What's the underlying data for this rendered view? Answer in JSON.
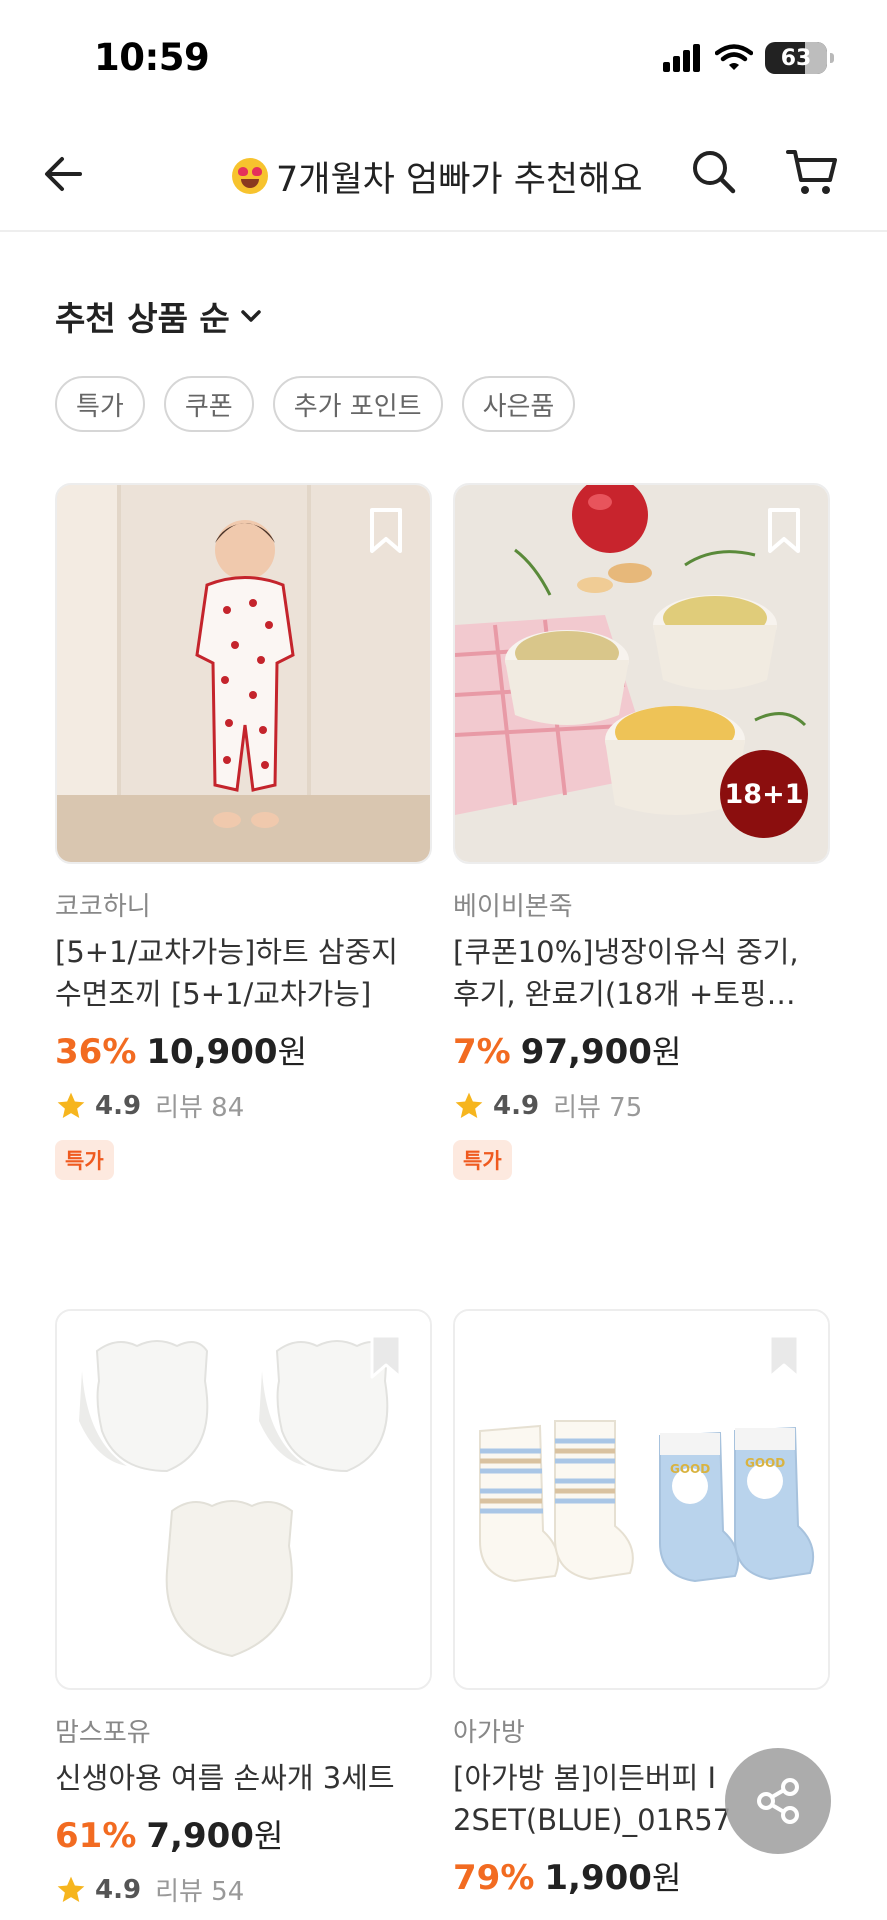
{
  "status_bar": {
    "time": "10:59",
    "battery": "63"
  },
  "nav": {
    "title": "7개월차 엄빠가 추천해요",
    "title_emoji": "smiling-face-with-heart-eyes-icon"
  },
  "sort": {
    "label": "추천 상품 순"
  },
  "filters": [
    "특가",
    "쿠폰",
    "추가 포인트",
    "사은품"
  ],
  "colors": {
    "discount": "#f26b21",
    "badge_bg": "#fde9df",
    "badge_text": "#ef5a1f",
    "star": "#f6b51e"
  },
  "products": [
    {
      "image": "baby-heart-sleepsuit-photo",
      "brand": "코코하니",
      "name": "[5+1/교차가능]하트 삼중지 수면조끼 [5+1/교차가능]",
      "discount": "36%",
      "price": "10,900",
      "currency": "원",
      "rating": "4.9",
      "review": "리뷰 84",
      "badge": "특가"
    },
    {
      "image": "baby-food-cups-photo",
      "image_badge": "18+1",
      "brand": "베이비본죽",
      "name": "[쿠폰10%]냉장이유식 중기, 후기, 완료기(18개 +토핑…",
      "discount": "7%",
      "price": "97,900",
      "currency": "원",
      "rating": "4.9",
      "review": "리뷰 75",
      "badge": "특가"
    },
    {
      "image": "newborn-mittens-photo",
      "brand": "맘스포유",
      "name": "신생아용 여름 손싸개 3세트",
      "discount": "61%",
      "price": "7,900",
      "currency": "원",
      "rating": "4.9",
      "review": "리뷰 54"
    },
    {
      "image": "baby-socks-photo",
      "brand": "아가방",
      "name": "[아가방 봄]이든버피 I 2SET(BLUE)_01R57",
      "discount": "79%",
      "price": "1,900",
      "currency": "원"
    }
  ]
}
